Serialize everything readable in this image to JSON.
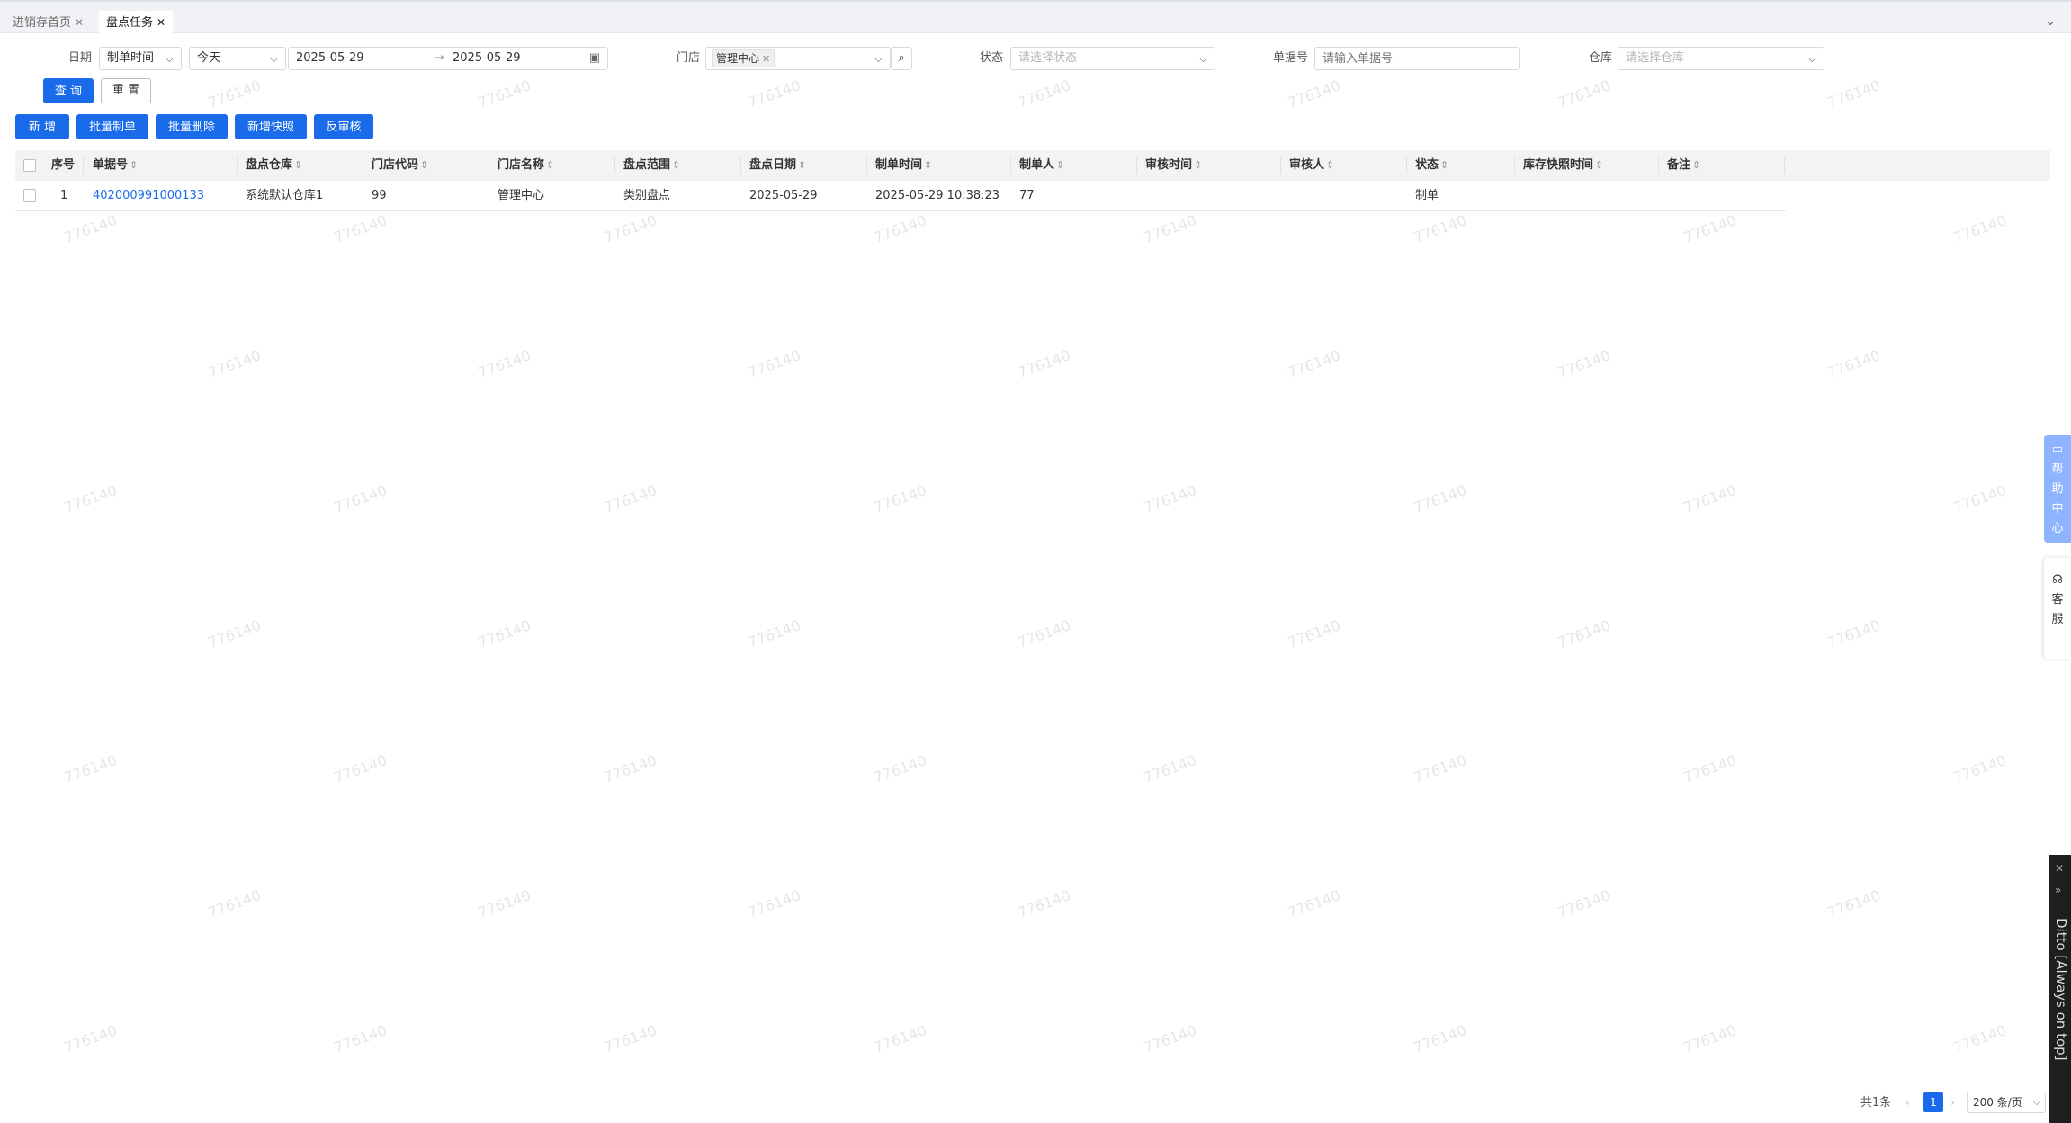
{
  "tabs": [
    {
      "label": "进销存首页",
      "active": false
    },
    {
      "label": "盘点任务",
      "active": true
    }
  ],
  "filters": {
    "date_label": "日期",
    "date_type": "制单时间",
    "date_range": "今天",
    "date_from": "2025-05-29",
    "date_sep": "→",
    "date_to": "2025-05-29",
    "store_label": "门店",
    "store_chip": "管理中心",
    "status_label": "状态",
    "status_placeholder": "请选择状态",
    "doc_no_label": "单据号",
    "doc_no_placeholder": "请输入单据号",
    "warehouse_label": "仓库",
    "warehouse_placeholder": "请选择仓库",
    "query_btn": "查 询",
    "reset_btn": "重 置"
  },
  "toolbar": {
    "add": "新 增",
    "batch_create": "批量制单",
    "batch_delete": "批量删除",
    "add_snapshot": "新增快照",
    "unaudit": "反审核"
  },
  "table": {
    "columns": [
      "序号",
      "单据号",
      "盘点仓库",
      "门店代码",
      "门店名称",
      "盘点范围",
      "盘点日期",
      "制单时间",
      "制单人",
      "审核时间",
      "审核人",
      "状态",
      "库存快照时间",
      "备注"
    ],
    "rows": [
      [
        "1",
        "402000991000133",
        "系统默认仓库1",
        "99",
        "管理中心",
        "类别盘点",
        "2025-05-29",
        "2025-05-29 10:38:23",
        "77",
        "",
        "",
        "制单",
        "",
        ""
      ]
    ]
  },
  "watermark": "776140",
  "side": {
    "help": [
      "帮",
      "助",
      "中",
      "心"
    ],
    "service": [
      "客",
      "服"
    ],
    "ditto": "Ditto [Always on top]"
  },
  "pagination": {
    "total": "共1条",
    "current": "1",
    "page_size": "200 条/页"
  },
  "colors": {
    "primary": "#1a6bea",
    "help_bg": "#8fb4ff",
    "header_bg": "#f2f3f5"
  }
}
